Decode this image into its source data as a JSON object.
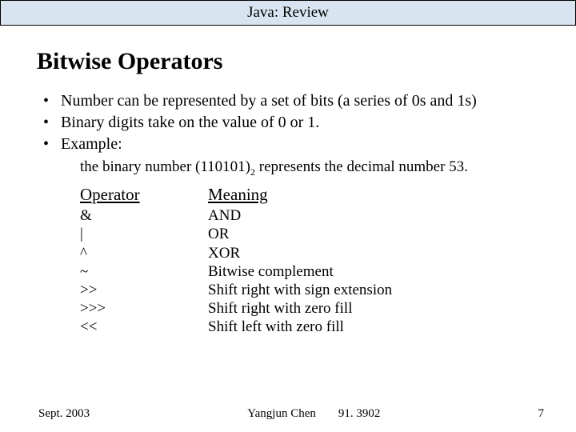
{
  "header": {
    "title": "Java: Review"
  },
  "heading": "Bitwise Operators",
  "bullets": [
    "Number can be represented by a set of bits (a series of 0s and 1s)",
    "Binary digits take on the value of 0 or 1.",
    "Example:"
  ],
  "example": {
    "prefix": "the binary number (110101)",
    "subscript": "2",
    "suffix": " represents the decimal number 53."
  },
  "table": {
    "head": {
      "c0": "Operator",
      "c1": "Meaning"
    },
    "rows": [
      {
        "op": "&",
        "mean": "AND"
      },
      {
        "op": "|",
        "mean": "OR"
      },
      {
        "op": "^",
        "mean": "XOR"
      },
      {
        "op": "~",
        "mean": "Bitwise complement"
      },
      {
        "op": ">>",
        "mean": "Shift right with sign extension"
      },
      {
        "op": ">>>",
        "mean": "Shift right with zero fill"
      },
      {
        "op": "<<",
        "mean": "Shift left with zero fill"
      }
    ]
  },
  "footer": {
    "date": "Sept. 2003",
    "author": "Yangjun Chen",
    "course": "91. 3902",
    "page": "7"
  }
}
